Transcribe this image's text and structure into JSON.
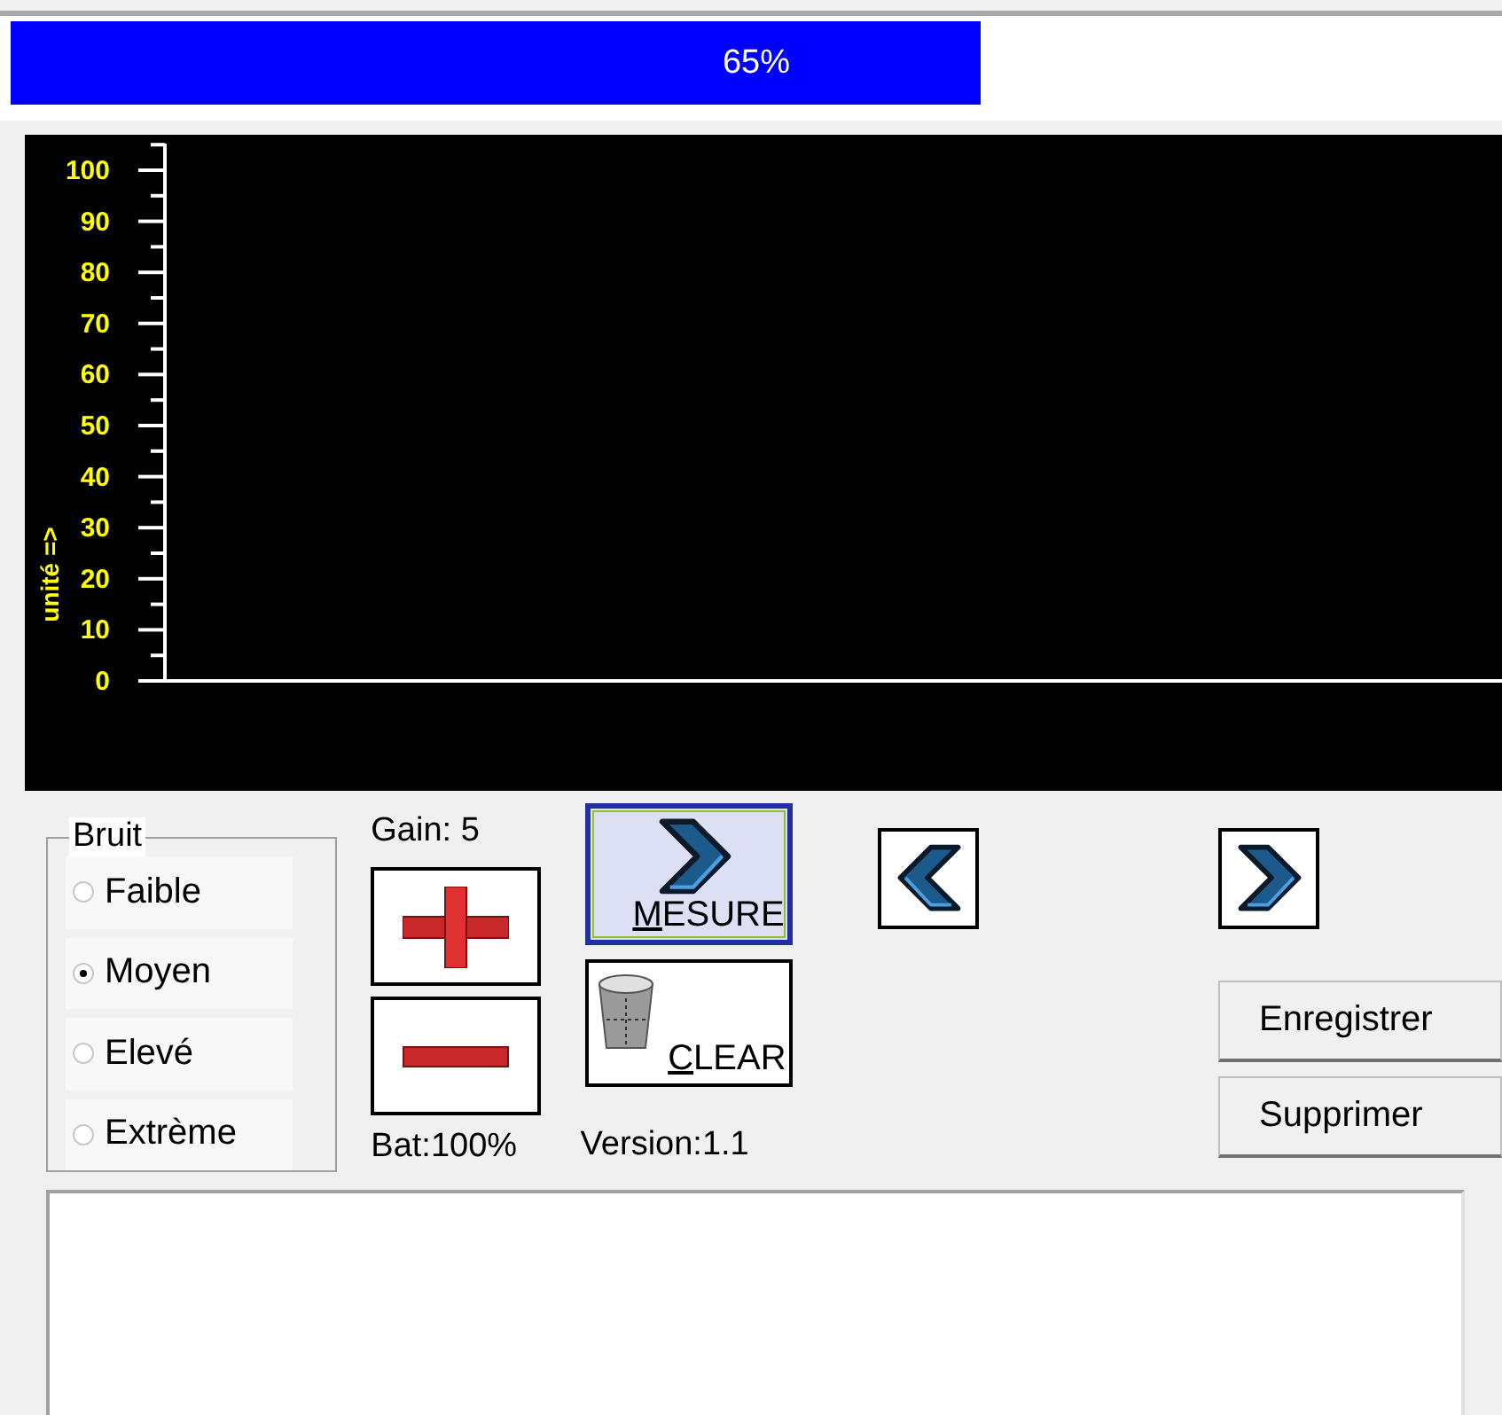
{
  "progress": {
    "level": 0.65,
    "label": "65%"
  },
  "chart": {
    "y_label": "unité =>",
    "y_ticks": [
      "100",
      "90",
      "80",
      "70",
      "60",
      "50",
      "40",
      "30",
      "20",
      "10",
      "0"
    ]
  },
  "noise": {
    "title": "Bruit",
    "options": [
      {
        "label": "Faible",
        "selected": false
      },
      {
        "label": "Moyen",
        "selected": true
      },
      {
        "label": "Elevé",
        "selected": false
      },
      {
        "label": "Extrème",
        "selected": false
      }
    ]
  },
  "gain": {
    "label": "Gain: 5",
    "battery": "Bat:100%"
  },
  "measure_button": {
    "label": "MESURE",
    "underline_first": true,
    "focused": true
  },
  "clear_button": {
    "label": "CLEAR",
    "underline_first": true,
    "focused": false
  },
  "version": "Version:1.1",
  "buttons": [
    {
      "label": "Enregistrer"
    },
    {
      "label": "Supprimer"
    }
  ]
}
